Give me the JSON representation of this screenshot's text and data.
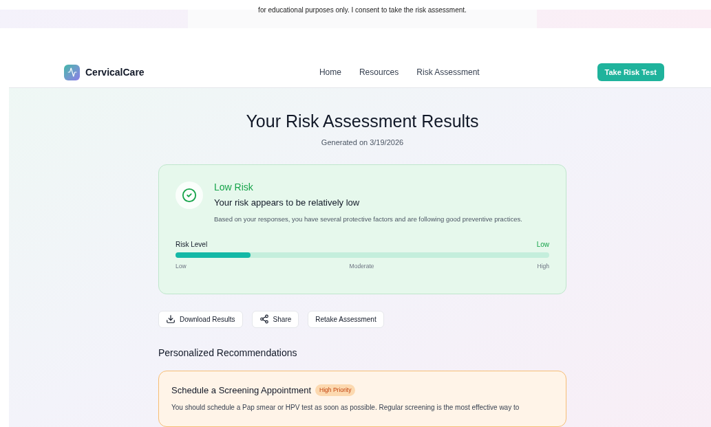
{
  "consent_strip": {
    "text": "for educational purposes only. I consent to take the risk assessment."
  },
  "nav": {
    "brand": "CervicalCare",
    "links": [
      {
        "label": "Home"
      },
      {
        "label": "Resources"
      },
      {
        "label": "Risk Assessment"
      }
    ],
    "cta": "Take Risk Test"
  },
  "header": {
    "title": "Your Risk Assessment Results",
    "generated": "Generated on 3/19/2026"
  },
  "result": {
    "kind": "low",
    "label": "Low Risk",
    "headline": "Your risk appears to be relatively low",
    "description": "Based on your responses, you have several protective factors and are following good preventive practices.",
    "meter_label": "Risk Level",
    "meter_value": "Low",
    "level": 0.2,
    "scale": [
      "Low",
      "Moderate",
      "High"
    ]
  },
  "actions": [
    {
      "kind": "download",
      "label": "Download Results"
    },
    {
      "kind": "share",
      "label": "Share"
    },
    {
      "kind": "plain",
      "label": "Retake Assessment"
    }
  ],
  "recommendations": {
    "title": "Personalized Recommendations",
    "items": [
      {
        "title": "Schedule a Screening Appointment",
        "priority": "High Priority",
        "text": "You should schedule a Pap smear or HPV test as soon as possible. Regular screening is the most effective way to"
      }
    ]
  }
}
